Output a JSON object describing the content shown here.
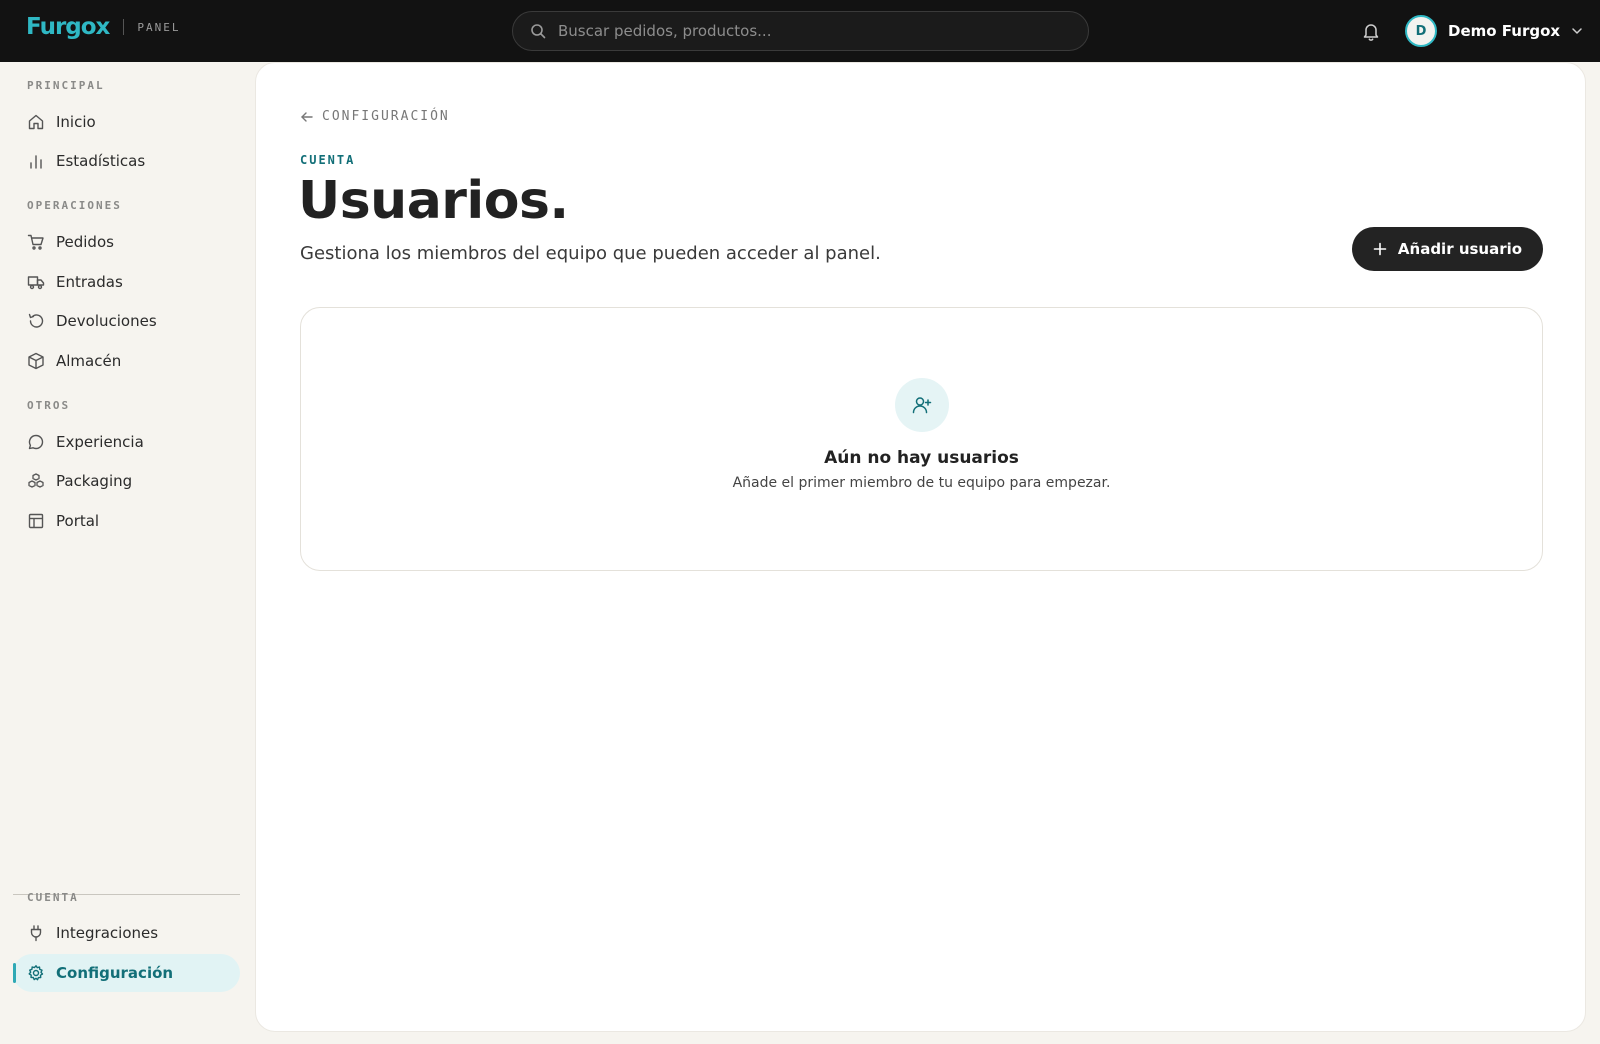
{
  "header": {
    "brand": "Furgox",
    "brand_sub": "PANEL",
    "search_placeholder": "Buscar pedidos, productos...",
    "user_initial": "D",
    "user_name": "Demo Furgox"
  },
  "sidebar": {
    "sections": [
      {
        "label": "PRINCIPAL",
        "items": [
          {
            "label": "Inicio",
            "icon": "home-icon"
          },
          {
            "label": "Estadísticas",
            "icon": "bar-chart-icon"
          }
        ]
      },
      {
        "label": "OPERACIONES",
        "items": [
          {
            "label": "Pedidos",
            "icon": "cart-icon"
          },
          {
            "label": "Entradas",
            "icon": "truck-icon"
          },
          {
            "label": "Devoluciones",
            "icon": "return-icon"
          },
          {
            "label": "Almacén",
            "icon": "box-icon"
          }
        ]
      },
      {
        "label": "OTROS",
        "items": [
          {
            "label": "Experiencia",
            "icon": "chat-icon"
          },
          {
            "label": "Packaging",
            "icon": "boxes-icon"
          },
          {
            "label": "Portal",
            "icon": "layout-icon"
          }
        ]
      },
      {
        "label": "CUENTA",
        "items": [
          {
            "label": "Integraciones",
            "icon": "plug-icon"
          },
          {
            "label": "Configuración",
            "icon": "gear-icon",
            "active": true
          }
        ]
      }
    ]
  },
  "main": {
    "back_label": "CONFIGURACIÓN",
    "eyebrow": "CUENTA",
    "title": "Usuarios.",
    "subtitle": "Gestiona los miembros del equipo que pueden acceder al panel.",
    "add_button": "Añadir usuario",
    "empty_state": {
      "icon": "user-plus-icon",
      "title": "Aún no hay usuarios",
      "subtitle": "Añade el primer miembro de tu equipo para empezar."
    }
  },
  "colors": {
    "accent": "#2fb8c4",
    "accent_dark": "#126f78",
    "topbar": "#121212",
    "sidebar_bg": "#f6f4ef",
    "active_bg": "#e1f3f4"
  }
}
